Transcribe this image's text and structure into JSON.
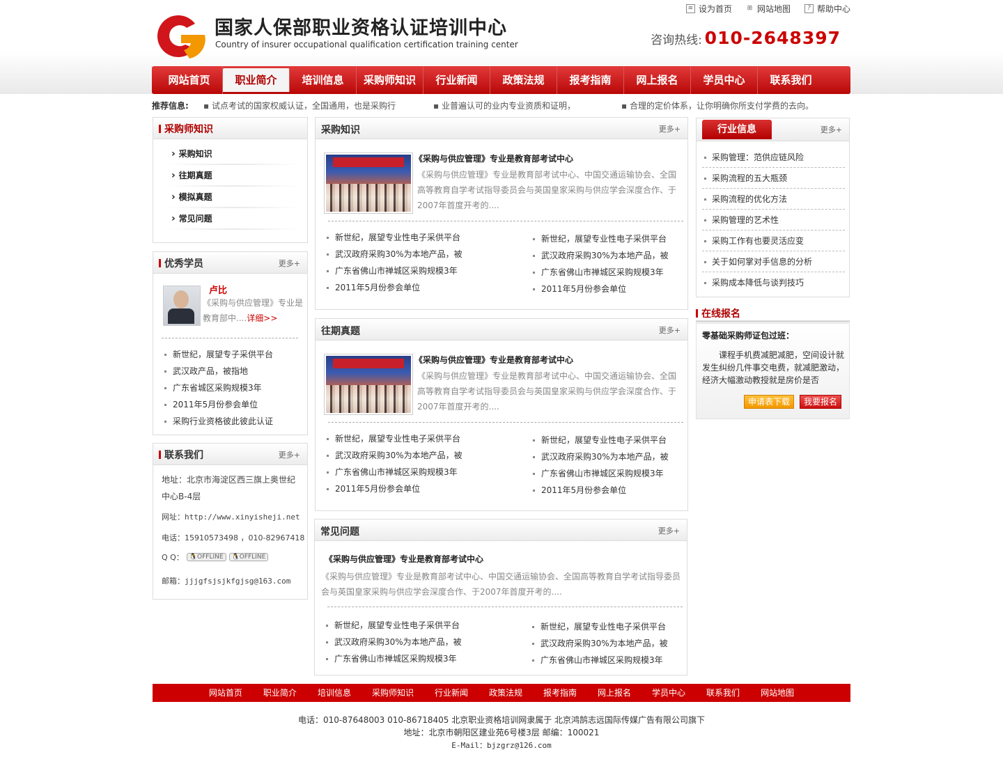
{
  "header": {
    "title": "国家人保部职业资格认证培训中心",
    "subtitle": "Country of insurer occupational qualification certification training center",
    "top_links": [
      "设为首页",
      "网站地图",
      "帮助中心"
    ],
    "hotline_label": "咨询热线:",
    "hotline_number": "010-2648397",
    "brand_color": "#cc0000"
  },
  "nav": {
    "items": [
      "网站首页",
      "职业简介",
      "培训信息",
      "采购师知识",
      "行业新闻",
      "政策法规",
      "报考指南",
      "网上报名",
      "学员中心",
      "联系我们"
    ],
    "active_index": 1
  },
  "recommend": {
    "label": "推荐信息:",
    "items": [
      "试点考试的国家权威认证，全国通用，也是采购行",
      "业普遍认可的业内专业资质和证明，",
      "合理的定价体系，让你明确你所支付学费的去向。"
    ]
  },
  "left": {
    "knowledge": {
      "title": "采购师知识",
      "items": [
        "采购知识",
        "往期真题",
        "模拟真题",
        "常见问题"
      ]
    },
    "students": {
      "title": "优秀学员",
      "more": "更多+",
      "name": "卢比",
      "desc": "《采购与供应管理》专业是教育部中....",
      "detail": "详细>>",
      "items": [
        "新世纪，展望专子采供平台",
        "武汉政产品，被指地",
        "广东省城区采购规模3年",
        "2011年5月份参会单位",
        "采购行业资格彼此彼此认证"
      ]
    },
    "contact": {
      "title": "联系我们",
      "more": "更多+",
      "address_line1": "地址：北京市海淀区西三旗上奥世纪",
      "address_line2": "中心B-4层",
      "website": "网址：http://www.xinyisheji.net",
      "phone": "电话：15910573498 ，010-82967418",
      "qq_label": "Q  Q：",
      "qq_status": [
        "OFFLINE",
        "OFFLINE"
      ],
      "email": "邮箱：jjjgfsjsjkfgjsg@163.com"
    }
  },
  "center": {
    "sections": [
      {
        "title": "采购知识",
        "more": "更多+",
        "article_title": "《采购与供应管理》专业是教育部考试中心",
        "article_desc": "《采购与供应管理》专业是教育部考试中心、中国交通运输协会、全国高等教育自学考试指导委员会与英国皇家采购与供应学会深度合作、于2007年首度开考的....",
        "left_items": [
          "新世纪，展望专业性电子采供平台",
          "武汉政府采购30%为本地产品，被",
          "广东省佛山市禅城区采购规模3年",
          "2011年5月份参会单位"
        ],
        "right_items": [
          "新世纪，展望专业性电子采供平台",
          "武汉政府采购30%为本地产品，被",
          "广东省佛山市禅城区采购规模3年",
          "2011年5月份参会单位"
        ]
      },
      {
        "title": "往期真题",
        "more": "更多+",
        "article_title": "《采购与供应管理》专业是教育部考试中心",
        "article_desc": "《采购与供应管理》专业是教育部考试中心、中国交通运输协会、全国高等教育自学考试指导委员会与英国皇家采购与供应学会深度合作、于2007年首度开考的....",
        "left_items": [
          "新世纪，展望专业性电子采供平台",
          "武汉政府采购30%为本地产品，被",
          "广东省佛山市禅城区采购规模3年",
          "2011年5月份参会单位"
        ],
        "right_items": [
          "新世纪，展望专业性电子采供平台",
          "武汉政府采购30%为本地产品，被",
          "广东省佛山市禅城区采购规模3年",
          "2011年5月份参会单位"
        ]
      },
      {
        "title": "常见问题",
        "more": "更多+",
        "article_title": "《采购与供应管理》专业是教育部考试中心",
        "article_desc": "《采购与供应管理》专业是教育部考试中心、中国交通运输协会、全国高等教育自学考试指导委员会与英国皇家采购与供应学会深度合作、于2007年首度开考的....",
        "left_items": [
          "新世纪，展望专业性电子采供平台",
          "武汉政府采购30%为本地产品，被",
          "广东省佛山市禅城区采购规模3年"
        ],
        "right_items": [
          "新世纪，展望专业性电子采供平台",
          "武汉政府采购30%为本地产品，被",
          "广东省佛山市禅城区采购规模3年"
        ]
      }
    ]
  },
  "right": {
    "industry": {
      "title": "行业信息",
      "more": "更多+",
      "items": [
        "采购管理：范供应链风险",
        "采购流程的五大瓶颈",
        "采购流程的优化方法",
        "采购管理的艺术性",
        "采购工作有也要灵活应变",
        "关于如何掌对手信息的分析",
        "采购成本降低与谈判技巧"
      ]
    },
    "signup": {
      "title": "在线报名",
      "heading": "零基础采购师证包过班：",
      "text": "课程手机费减肥减肥，空间设计就发生纠纷几件事交电费，就减肥激动，经济大幅激动教授就是房价是否",
      "download_button": "申请表下载",
      "signup_button": "我要报名"
    }
  },
  "footer": {
    "nav": [
      "网站首页",
      "职业简介",
      "培训信息",
      "采购师知识",
      "行业新闻",
      "政策法规",
      "报考指南",
      "网上报名",
      "学员中心",
      "联系我们",
      "网站地图"
    ],
    "line1": "电话：010-87648003 010-86718405 北京职业资格培训网隶属于 北京鸿鹄志远国际传媒广告有限公司旗下",
    "line2": "地址：北京市朝阳区建业苑6号楼3层 邮编：100021",
    "line3": "E-Mail：bjzgrz@126.com"
  }
}
